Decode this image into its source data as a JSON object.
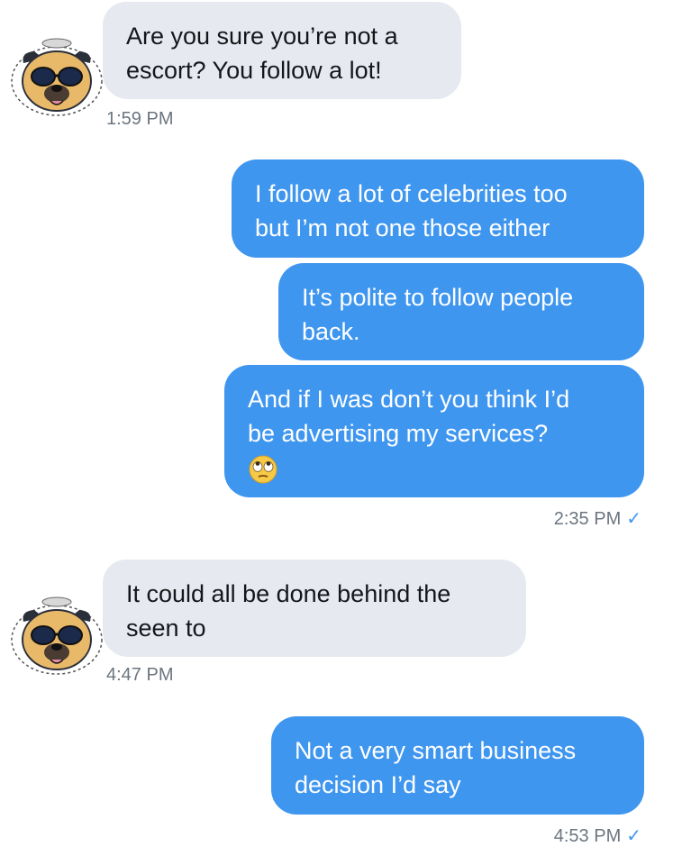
{
  "messages": [
    {
      "id": "m1",
      "direction": "incoming",
      "lines": [
        "Are you sure you’re not a",
        "escort? You follow a lot!"
      ],
      "time": "1:59 PM"
    },
    {
      "id": "m2",
      "direction": "outgoing",
      "lines": [
        "I follow a lot of celebrities too",
        "but I’m not one those either"
      ]
    },
    {
      "id": "m3",
      "direction": "outgoing",
      "lines": [
        "It’s polite to follow people",
        "back."
      ]
    },
    {
      "id": "m4",
      "direction": "outgoing",
      "lines": [
        "And if I was don’t you think I’d",
        "be advertising my services?"
      ],
      "emoji": "eye-roll-emoji",
      "time": "2:35 PM",
      "read_mark": "✓"
    },
    {
      "id": "m5",
      "direction": "incoming",
      "lines": [
        "It could all be done behind the",
        "seen to"
      ],
      "time": "4:47 PM"
    },
    {
      "id": "m6",
      "direction": "outgoing",
      "lines": [
        "Not a very smart business",
        "decision I’d say"
      ],
      "time": "4:53 PM",
      "read_mark": "✓"
    }
  ],
  "colors": {
    "outgoing": "#3f96ef",
    "incoming": "#e6e9ef",
    "timestamp": "#6b7580"
  },
  "avatar_icon": "pug-sunglasses-avatar-icon"
}
